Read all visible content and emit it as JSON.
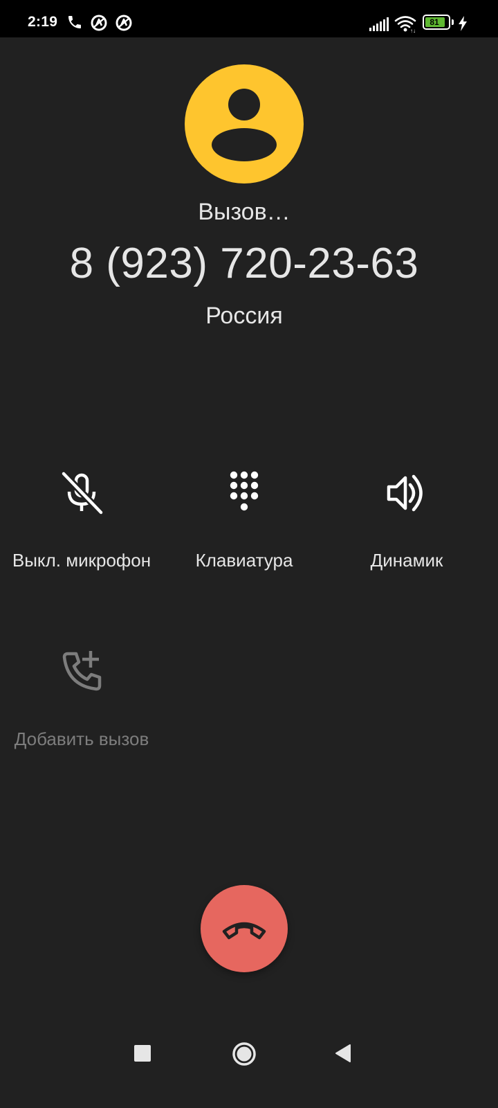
{
  "status_bar": {
    "time": "2:19",
    "battery_level": "81",
    "icons": [
      "phone-icon",
      "vpn-icon",
      "vpn-icon",
      "signal-icon",
      "wifi-icon",
      "battery-icon",
      "charging-icon"
    ]
  },
  "call": {
    "status": "Вызов…",
    "number": "8 (923) 720-23-63",
    "location": "Россия"
  },
  "actions": {
    "mute": {
      "label": "Выкл. микрофон",
      "icon": "mic-off-icon"
    },
    "keypad": {
      "label": "Клавиатура",
      "icon": "dialpad-icon"
    },
    "speaker": {
      "label": "Динамик",
      "icon": "speaker-icon"
    },
    "add_call": {
      "label": "Добавить вызов",
      "icon": "add-call-icon",
      "enabled": false
    }
  },
  "end_call": {
    "icon": "end-call-icon",
    "color": "#e6675f"
  },
  "avatar": {
    "color": "#fec52e",
    "icon": "person-icon"
  },
  "nav_bar": {
    "buttons": [
      "recents-icon",
      "home-icon",
      "back-icon"
    ]
  }
}
